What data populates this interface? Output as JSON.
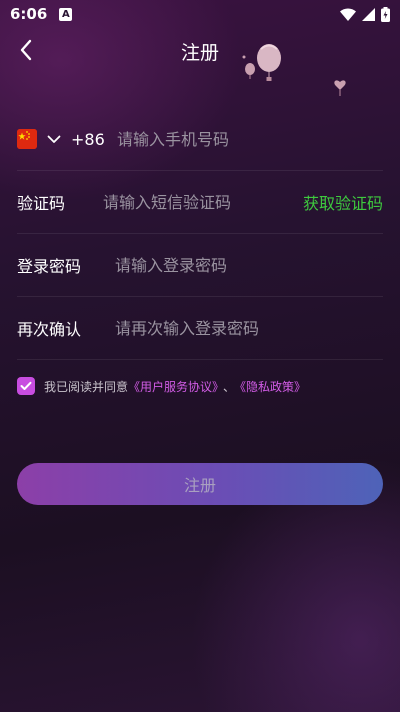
{
  "status_bar": {
    "time": "6:06",
    "notification_letter": "A"
  },
  "header": {
    "title": "注册"
  },
  "phone": {
    "country_code": "+86",
    "placeholder": "请输入手机号码"
  },
  "sms_code": {
    "label": "验证码",
    "placeholder": "请输入短信验证码",
    "get_code_label": "获取验证码"
  },
  "password": {
    "label": "登录密码",
    "placeholder": "请输入登录密码"
  },
  "confirm_password": {
    "label": "再次确认",
    "placeholder": "请再次输入登录密码"
  },
  "agreement": {
    "checked": true,
    "prefix": "我已阅读并同意",
    "user_agreement": "《用户服务协议》",
    "separator": "、",
    "privacy_policy": "《隐私政策》"
  },
  "submit": {
    "label": "注册"
  },
  "colors": {
    "accent_green": "#3ec93e",
    "accent_purple": "#d25ce6"
  }
}
